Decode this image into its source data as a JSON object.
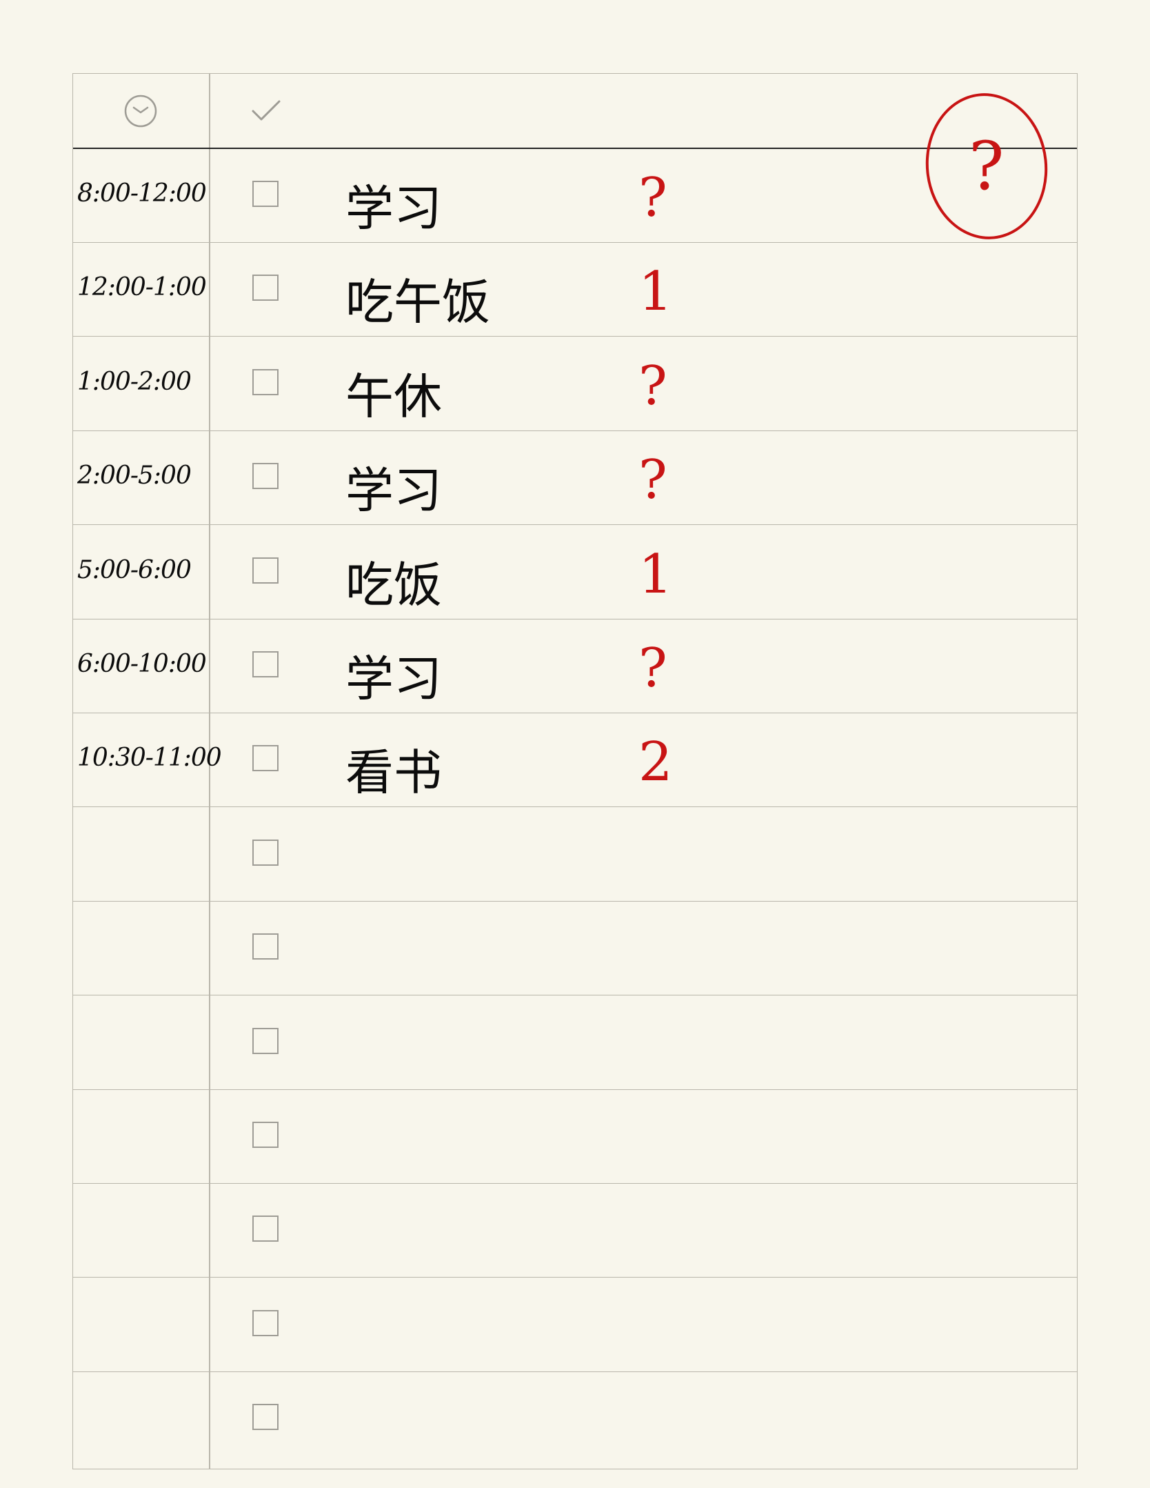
{
  "header": {
    "icons": [
      "clock-icon",
      "checkmark-icon"
    ]
  },
  "rows": [
    {
      "time": "8:00-12:00",
      "task": "学习",
      "mark": "?"
    },
    {
      "time": "12:00-1:00",
      "task": "吃午饭",
      "mark": "1"
    },
    {
      "time": "1:00-2:00",
      "task": "午休",
      "mark": "?"
    },
    {
      "time": "2:00-5:00",
      "task": "学习",
      "mark": "?"
    },
    {
      "time": "5:00-6:00",
      "task": "吃饭",
      "mark": "1"
    },
    {
      "time": "6:00-10:00",
      "task": "学习",
      "mark": "?"
    },
    {
      "time": "10:30-11:00",
      "task": "看书",
      "mark": "2"
    },
    {
      "time": "",
      "task": "",
      "mark": ""
    },
    {
      "time": "",
      "task": "",
      "mark": ""
    },
    {
      "time": "",
      "task": "",
      "mark": ""
    },
    {
      "time": "",
      "task": "",
      "mark": ""
    },
    {
      "time": "",
      "task": "",
      "mark": ""
    },
    {
      "time": "",
      "task": "",
      "mark": ""
    },
    {
      "time": "",
      "task": "",
      "mark": ""
    }
  ],
  "annotation": {
    "circled_mark": "?"
  },
  "colors": {
    "paper": "#f8f6ec",
    "grid": "#b9b6ab",
    "ink": "#0c0c0c",
    "red_pen": "#c81414"
  }
}
